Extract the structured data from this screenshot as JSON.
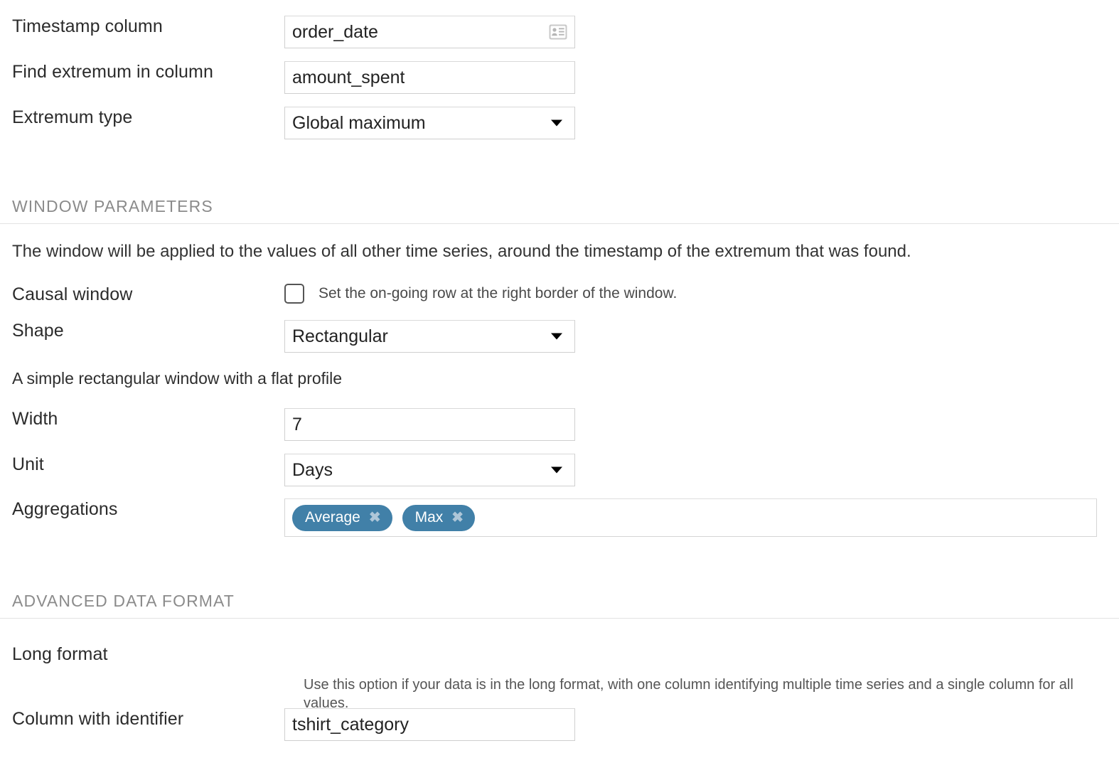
{
  "form": {
    "timestamp_column": {
      "label": "Timestamp column",
      "value": "order_date",
      "icon": "id-card-icon"
    },
    "find_extremum_in_column": {
      "label": "Find extremum in column",
      "value": "amount_spent"
    },
    "extremum_type": {
      "label": "Extremum type",
      "value": "Global maximum"
    }
  },
  "window_parameters": {
    "section_title": "WINDOW PARAMETERS",
    "description": "The window will be applied to the values of all other time series, around the timestamp of the extremum that was found.",
    "causal_window": {
      "label": "Causal window",
      "checked": false,
      "help": "Set the on-going row at the right border of the window."
    },
    "shape": {
      "label": "Shape",
      "value": "Rectangular",
      "description": "A simple rectangular window with a flat profile"
    },
    "width": {
      "label": "Width",
      "value": "7"
    },
    "unit": {
      "label": "Unit",
      "value": "Days"
    },
    "aggregations": {
      "label": "Aggregations",
      "tags": [
        "Average",
        "Max"
      ],
      "remove_glyph": "✖"
    }
  },
  "advanced_data_format": {
    "section_title": "ADVANCED DATA FORMAT",
    "long_format": {
      "label": "Long format",
      "checked": true,
      "help": "Use this option if your data is in the long format, with one column identifying multiple time series and a single column for all values."
    },
    "column_with_identifier": {
      "label": "Column with identifier",
      "value": "tshirt_category"
    }
  },
  "colors": {
    "tag_background": "#4180a8",
    "checkbox_checked": "#1479f0",
    "section_title": "#8b8b8b",
    "border": "#cfcfcf"
  }
}
